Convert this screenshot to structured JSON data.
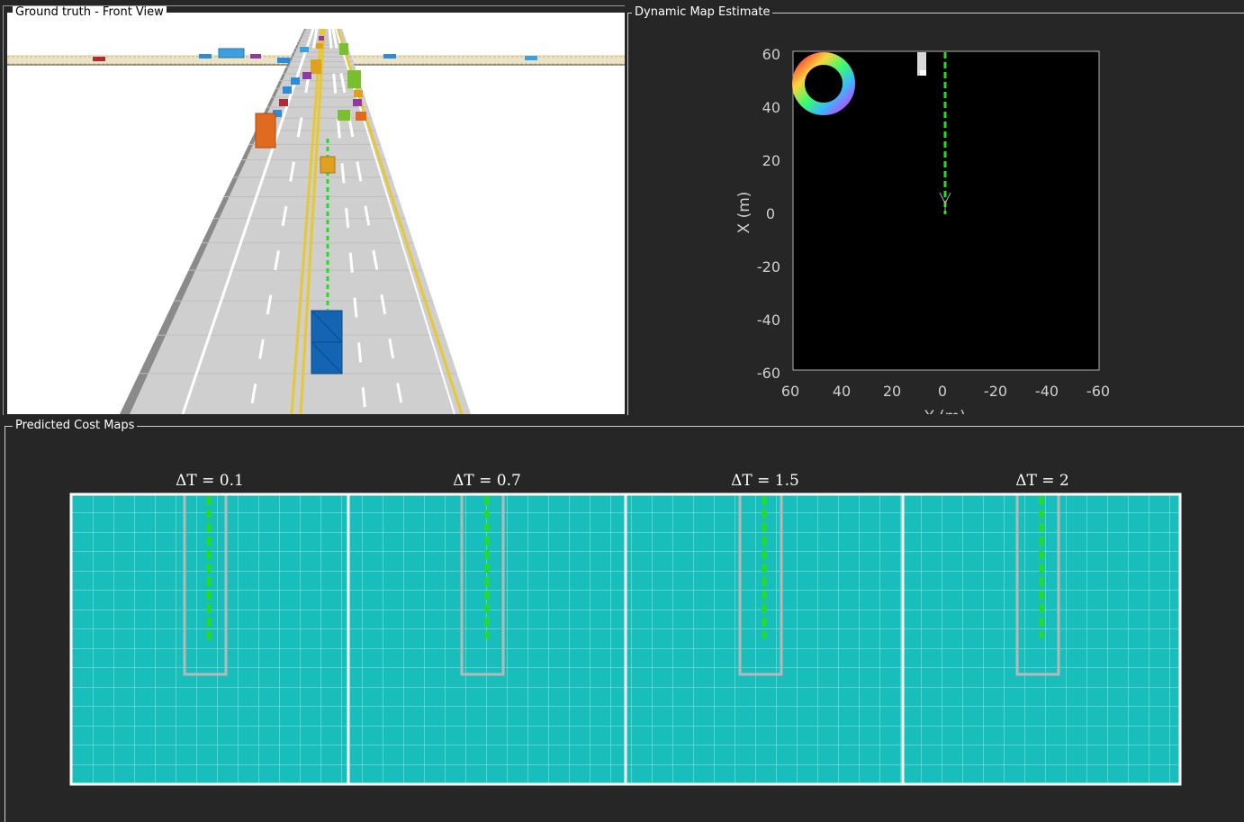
{
  "panels": {
    "front_view": {
      "title": "Ground truth - Front View"
    },
    "map": {
      "title": "Dynamic Map Estimate",
      "y_ticks": [
        "60",
        "40",
        "20",
        "0",
        "-20",
        "-40",
        "-60"
      ],
      "x_ticks": [
        "60",
        "40",
        "20",
        "0",
        "-20",
        "-40",
        "-60"
      ],
      "ylabel": "X (m)",
      "xlabel": "Y (m)"
    },
    "cost_maps": {
      "title": "Predicted Cost Maps",
      "maps": [
        {
          "label": "ΔT = 0.1"
        },
        {
          "label": "ΔT = 0.7"
        },
        {
          "label": "ΔT = 1.5"
        },
        {
          "label": "ΔT = 2"
        }
      ]
    }
  },
  "colors": {
    "background": "#262626",
    "costmap": "#17bebb",
    "trajectory": "#22dd22",
    "ego": "#1464b4"
  }
}
